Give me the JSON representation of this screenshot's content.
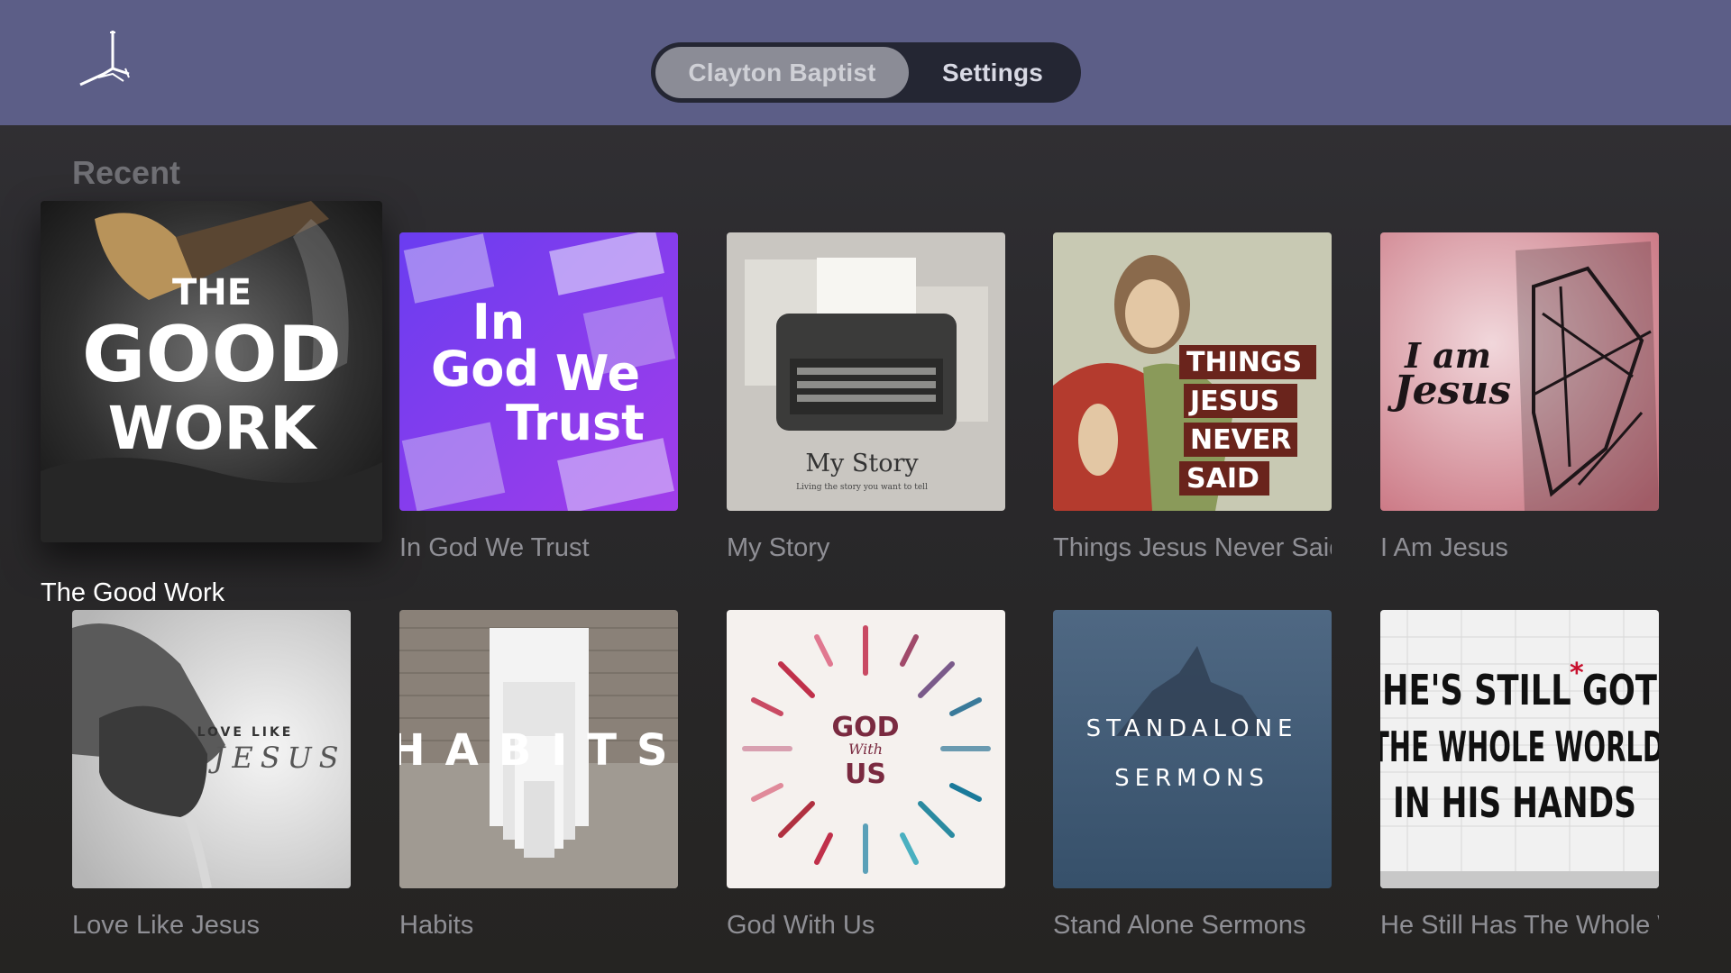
{
  "header": {
    "tabs": [
      {
        "label": "Clayton Baptist",
        "active": true
      },
      {
        "label": "Settings",
        "active": false
      }
    ]
  },
  "section": {
    "title": "Recent"
  },
  "items": [
    {
      "title": "The Good Work",
      "art_text": [
        "THE",
        "GOOD",
        "WORK"
      ],
      "focused": true
    },
    {
      "title": "In God We Trust",
      "art_text": [
        "In",
        "God",
        "We",
        "Trust"
      ]
    },
    {
      "title": "My Story",
      "art_text": [
        "My Story",
        "Living the story you want to tell"
      ]
    },
    {
      "title": "Things Jesus Never Said",
      "art_text": [
        "THINGS",
        "JESUS",
        "NEVER",
        "SAID"
      ]
    },
    {
      "title": "I Am Jesus",
      "art_text": [
        "I am",
        "Jesus"
      ]
    },
    {
      "title": "Love Like Jesus",
      "art_text": [
        "LOVE LIKE",
        "JESUS"
      ]
    },
    {
      "title": "Habits",
      "art_text": [
        "HABITS"
      ]
    },
    {
      "title": "God With Us",
      "art_text": [
        "GOD",
        "With",
        "US"
      ]
    },
    {
      "title": "Stand Alone Sermons",
      "art_text": [
        "STANDALONE",
        "SERMONS"
      ]
    },
    {
      "title": "He Still Has The Whole World In His Hands",
      "art_text": [
        "HE'S STILL GOT",
        "THE WHOLE WORLD",
        "IN HIS HANDS"
      ]
    }
  ],
  "colors": {
    "header_bg": "#5c5e87",
    "segment_bg": "#242633",
    "segment_active": "#8b8c96",
    "caption": "#8f8f95",
    "caption_focused": "#ffffff"
  }
}
